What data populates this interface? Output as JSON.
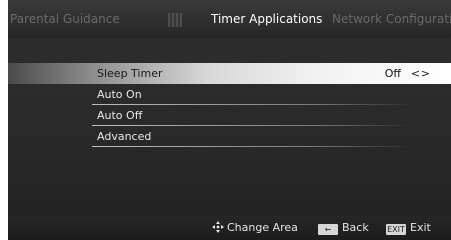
{
  "tabs": [
    {
      "label": "Parental Guidance",
      "active": false
    },
    {
      "label": "Timer Applications",
      "active": true
    },
    {
      "label": "Network Configuration",
      "active": false
    }
  ],
  "tab_icon": "timer-icon",
  "menu": {
    "items": [
      {
        "label": "Sleep Timer",
        "value": "Off",
        "selected": true,
        "arrows": "< >"
      },
      {
        "label": "Auto On",
        "selected": false
      },
      {
        "label": "Auto Off",
        "selected": false
      },
      {
        "label": "Advanced",
        "selected": false
      }
    ]
  },
  "hints": {
    "area": {
      "label": "Change Area",
      "icon": "dpad-icon"
    },
    "back": {
      "label": "Back",
      "key": "←",
      "icon": "back-key-icon"
    },
    "exit": {
      "label": "Exit",
      "key": "EXIT",
      "icon": "exit-key-icon"
    }
  },
  "colors": {
    "background": "#2a2a2a",
    "selected_text": "#1a1a1a",
    "inactive_tab": "#6a6a6a",
    "active_tab": "#ffffff"
  }
}
